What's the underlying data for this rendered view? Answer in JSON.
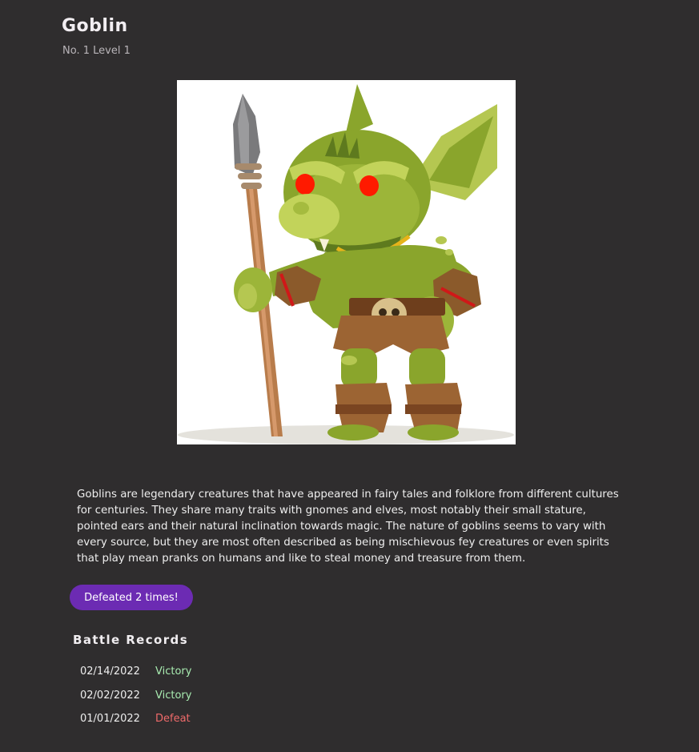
{
  "header": {
    "title": "Goblin",
    "subtitle": "No. 1 Level 1"
  },
  "description": "Goblins are legendary creatures that have appeared in fairy tales and folklore from different cultures for centuries. They share many traits with gnomes and elves, most notably their small stature, pointed ears and their natural inclination towards magic. The nature of goblins seems to vary with every source, but they are most often described as being mischievous fey creatures or even spirits that play mean pranks on humans and like to steal money and treasure from them.",
  "defeat_badge": "Defeated 2 times!",
  "battle_records": {
    "heading": "Battle Records",
    "entries": [
      {
        "date": "02/14/2022",
        "result": "Victory"
      },
      {
        "date": "02/02/2022",
        "result": "Victory"
      },
      {
        "date": "01/01/2022",
        "result": "Defeat"
      }
    ]
  },
  "colors": {
    "background": "#2f2d2e",
    "accent": "#6c2bb3",
    "victory": "#a8ebb0",
    "defeat": "#ef6a6a"
  }
}
